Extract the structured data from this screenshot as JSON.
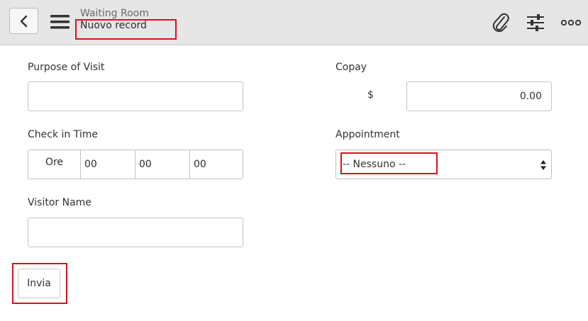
{
  "header": {
    "app_title": "Waiting Room",
    "record_title": "Nuovo record",
    "icons": [
      "chevron-left-icon",
      "hamburger-icon",
      "paperclip-icon",
      "sliders-icon",
      "more-icon"
    ]
  },
  "form": {
    "purpose_label": "Purpose of Visit",
    "purpose_value": "",
    "copay_label": "Copay",
    "copay_currency": "$",
    "copay_value": "0.00",
    "checkin_label": "Check in Time",
    "checkin_prefix": "Ore",
    "checkin_hours": "00",
    "checkin_minutes": "00",
    "checkin_seconds": "00",
    "appointment_label": "Appointment",
    "appointment_value": "-- Nessuno --",
    "visitor_label": "Visitor Name",
    "visitor_value": ""
  },
  "actions": {
    "submit_label": "Invia"
  },
  "colors": {
    "highlight": "#d6131e",
    "header_bg": "#e6e6e6"
  }
}
